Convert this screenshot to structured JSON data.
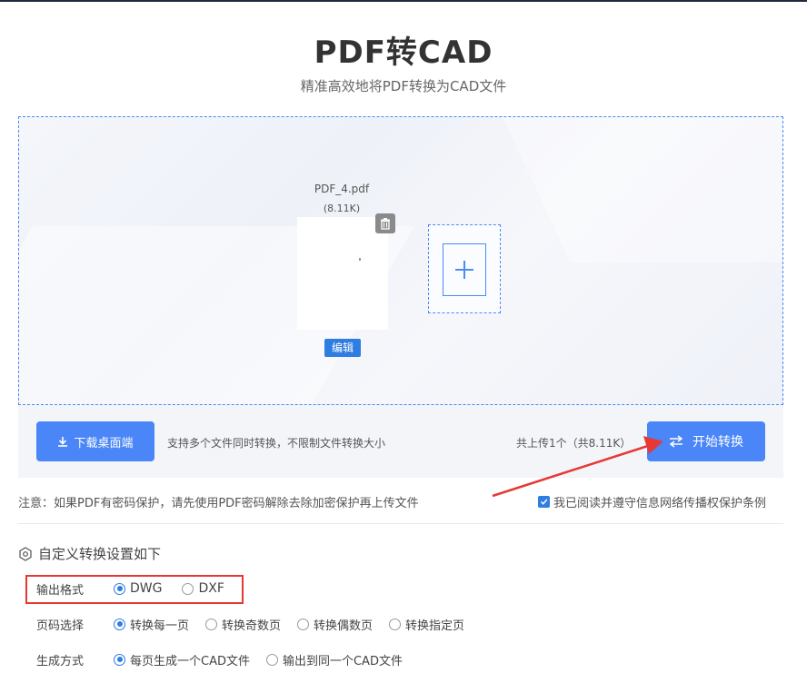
{
  "header": {
    "title": "PDF转CAD",
    "subtitle": "精准高效地将PDF转换为CAD文件"
  },
  "file": {
    "name": "PDF_4.pdf",
    "size": "(8.11K)",
    "edit_label": "编辑"
  },
  "actions": {
    "download_label": "下载桌面端",
    "support_text": "支持多个文件同时转换，不限制文件转换大小",
    "upload_count": "共上传1个（共8.11K）",
    "start_label": "开始转换"
  },
  "notice": "注意：如果PDF有密码保护，请先使用PDF密码解除去除加密保护再上传文件",
  "agreement": {
    "label": "我已阅读并遵守信息网络传播权保护条例",
    "checked": true
  },
  "settings": {
    "title": "自定义转换设置如下",
    "output_format": {
      "label": "输出格式",
      "options": [
        "DWG",
        "DXF"
      ],
      "selected": "DWG"
    },
    "page_selection": {
      "label": "页码选择",
      "options": [
        "转换每一页",
        "转换奇数页",
        "转换偶数页",
        "转换指定页"
      ],
      "selected": "转换每一页"
    },
    "generate_mode": {
      "label": "生成方式",
      "options": [
        "每页生成一个CAD文件",
        "输出到同一个CAD文件"
      ],
      "selected": "每页生成一个CAD文件"
    }
  },
  "colors": {
    "accent": "#4a86f7",
    "highlight": "#e53935"
  }
}
